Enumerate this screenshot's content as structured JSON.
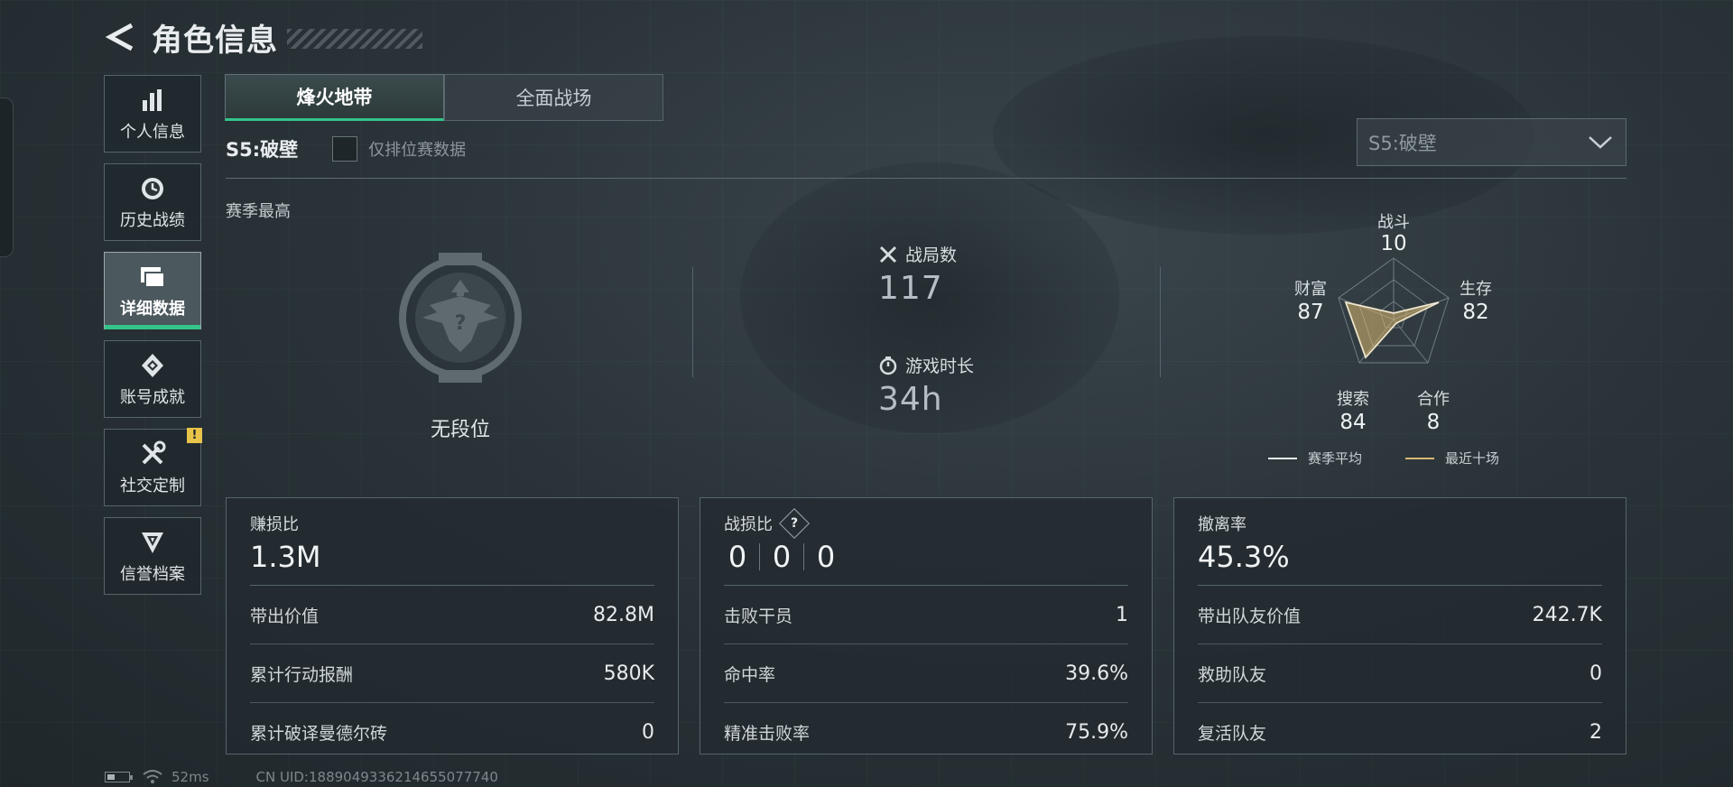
{
  "header": {
    "title": "角色信息"
  },
  "sidebar": {
    "items": [
      {
        "label": "个人信息",
        "icon": "bar-chart-icon"
      },
      {
        "label": "历史战绩",
        "icon": "history-clock-icon"
      },
      {
        "label": "详细数据",
        "icon": "cards-icon",
        "active": true
      },
      {
        "label": "账号成就",
        "icon": "medal-icon"
      },
      {
        "label": "社交定制",
        "icon": "tools-icon",
        "badge": "!"
      },
      {
        "label": "信誉档案",
        "icon": "shield-badge-icon"
      }
    ]
  },
  "mode_tabs": [
    {
      "label": "烽火地带",
      "active": true
    },
    {
      "label": "全面战场",
      "active": false
    }
  ],
  "season": {
    "name": "S5:破壁",
    "ranked_only_label": "仅排位赛数据",
    "ranked_only_checked": false,
    "select_value": "S5:破壁"
  },
  "season_best": {
    "label": "赛季最高",
    "rank": "无段位"
  },
  "overview": {
    "matches_label": "战局数",
    "matches_value": "117",
    "playtime_label": "游戏时长",
    "playtime_value": "34h"
  },
  "radar": {
    "axes": [
      {
        "label": "战斗",
        "value": "10"
      },
      {
        "label": "生存",
        "value": "82"
      },
      {
        "label": "合作",
        "value": "8"
      },
      {
        "label": "搜索",
        "value": "84"
      },
      {
        "label": "财富",
        "value": "87"
      }
    ],
    "legend": [
      {
        "label": "赛季平均",
        "color": "#e8ecee"
      },
      {
        "label": "最近十场",
        "color": "#d8b870"
      }
    ]
  },
  "panels": {
    "profit": {
      "title": "赚损比",
      "big": "1.3M",
      "rows": [
        {
          "k": "带出价值",
          "v": "82.8M"
        },
        {
          "k": "累计行动报酬",
          "v": "580K"
        },
        {
          "k": "累计破译曼德尔砖",
          "v": "0"
        }
      ]
    },
    "combat": {
      "title": "战损比",
      "help": "?",
      "kd": [
        "0",
        "0",
        "0"
      ],
      "rows": [
        {
          "k": "击败干员",
          "v": "1"
        },
        {
          "k": "命中率",
          "v": "39.6%"
        },
        {
          "k": "精准击败率",
          "v": "75.9%"
        }
      ]
    },
    "extract": {
      "title": "撤离率",
      "big": "45.3%",
      "rows": [
        {
          "k": "带出队友价值",
          "v": "242.7K"
        },
        {
          "k": "救助队友",
          "v": "0"
        },
        {
          "k": "复活队友",
          "v": "2"
        }
      ]
    }
  },
  "status_bar": {
    "ping": "52ms",
    "uid": "CN UID:1889049336214655077740"
  },
  "colors": {
    "accent": "#33c48a",
    "badge": "#e8c44a",
    "recent": "#d8b870"
  }
}
